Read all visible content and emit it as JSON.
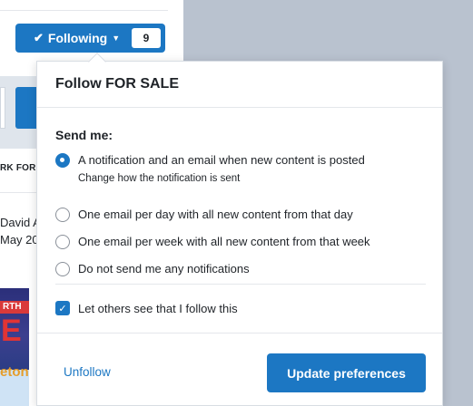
{
  "background": {
    "follow_button": {
      "label": "Following",
      "count": "9"
    },
    "forum_label": "RK FORU",
    "author_line1": "David A",
    "author_line2": "May 20",
    "thumb_top_text": "RTH",
    "thumb_big_text": "E",
    "thumb_bottom_text": "eton"
  },
  "modal": {
    "title": "Follow FOR SALE",
    "send_label": "Send me:",
    "options": [
      {
        "label": "A notification and an email when new content is posted",
        "hint": "Change how the notification is sent",
        "selected": true
      },
      {
        "label": "One email per day with all new content from that day",
        "selected": false
      },
      {
        "label": "One email per week with all new content from that week",
        "selected": false
      },
      {
        "label": "Do not send me any notifications",
        "selected": false
      }
    ],
    "visibility_checkbox": {
      "label": "Let others see that I follow this",
      "checked": true
    },
    "unfollow_label": "Unfollow",
    "submit_label": "Update preferences"
  },
  "colors": {
    "accent": "#1c77c3",
    "backdrop": "#b9c2cf"
  }
}
